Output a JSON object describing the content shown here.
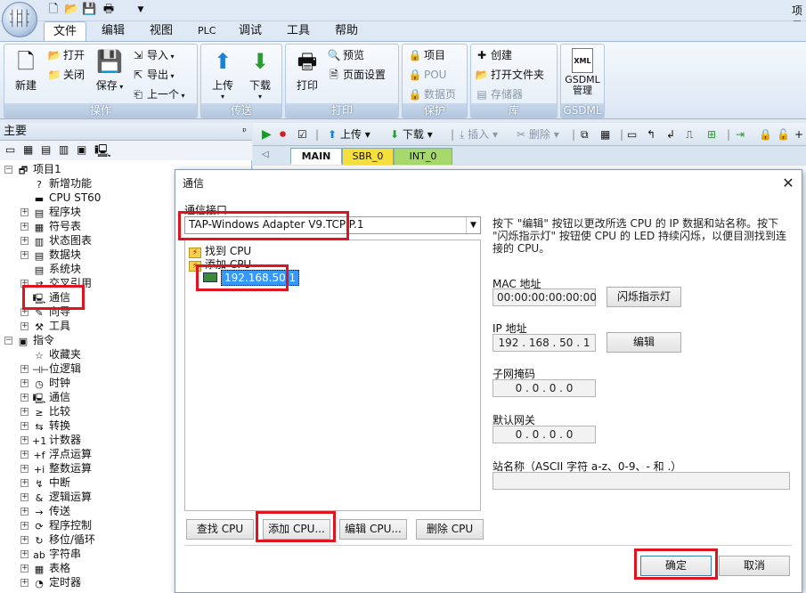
{
  "window": {
    "title_fragment": "项目"
  },
  "qat": {
    "dropdown": "▼"
  },
  "menu": {
    "tabs": [
      "文件",
      "编辑",
      "视图",
      "PLC",
      "调试",
      "工具",
      "帮助"
    ]
  },
  "ribbon": {
    "groups": {
      "operation": {
        "caption": "操作",
        "new_label": "新建",
        "open_label": "打开",
        "close_label": "关闭",
        "save_label": "保存",
        "import_label": "导入",
        "export_label": "导出",
        "previous_label": "上一个"
      },
      "transfer": {
        "caption": "传送",
        "upload_label": "上传",
        "download_label": "下载"
      },
      "print": {
        "caption": "打印",
        "print_label": "打印",
        "preview_label": "预览",
        "page_setup_label": "页面设置"
      },
      "protect": {
        "caption": "保护",
        "project_label": "项目",
        "pou_label": "POU",
        "data_page_label": "数据页"
      },
      "library": {
        "caption": "库",
        "create_label": "创建",
        "open_folder_label": "打开文件夹",
        "memory_label": "存储器"
      },
      "gsdml": {
        "caption": "GSDML",
        "icon_text": "XML",
        "manage_line1": "GSDML",
        "manage_line2": "管理"
      }
    }
  },
  "left_panel": {
    "header": "主要",
    "pin": "ᵖ",
    "tree": [
      {
        "label": "项目1",
        "indent": 0,
        "expander": "−",
        "icon": "project-icon"
      },
      {
        "label": "新增功能",
        "indent": 1,
        "icon": "help-icon"
      },
      {
        "label": "CPU ST60",
        "indent": 1,
        "icon": "cpu-icon"
      },
      {
        "label": "程序块",
        "indent": 1,
        "expander": "+",
        "icon": "folder-icon"
      },
      {
        "label": "符号表",
        "indent": 1,
        "expander": "+",
        "icon": "table-icon"
      },
      {
        "label": "状态图表",
        "indent": 1,
        "expander": "+",
        "icon": "chart-icon"
      },
      {
        "label": "数据块",
        "indent": 1,
        "expander": "+",
        "icon": "data-block-icon"
      },
      {
        "label": "系统块",
        "indent": 1,
        "icon": "system-block-icon"
      },
      {
        "label": "交叉引用",
        "indent": 1,
        "expander": "+",
        "icon": "cross-ref-icon"
      },
      {
        "label": "通信",
        "indent": 1,
        "icon": "communication-icon"
      },
      {
        "label": "向导",
        "indent": 1,
        "expander": "+",
        "icon": "wizard-icon"
      },
      {
        "label": "工具",
        "indent": 1,
        "expander": "+",
        "icon": "tools-icon"
      },
      {
        "label": "指令",
        "indent": 0,
        "expander": "−",
        "icon": "instructions-icon"
      },
      {
        "label": "收藏夹",
        "indent": 1,
        "icon": "favorites-icon"
      },
      {
        "label": "位逻辑",
        "indent": 1,
        "expander": "+",
        "icon": "bit-logic-icon"
      },
      {
        "label": "时钟",
        "indent": 1,
        "expander": "+",
        "icon": "clock-icon"
      },
      {
        "label": "通信",
        "indent": 1,
        "expander": "+",
        "icon": "communication-icon"
      },
      {
        "label": "比较",
        "indent": 1,
        "expander": "+",
        "icon": "compare-icon"
      },
      {
        "label": "转换",
        "indent": 1,
        "expander": "+",
        "icon": "convert-icon"
      },
      {
        "label": "计数器",
        "indent": 1,
        "expander": "+",
        "icon": "counter-icon"
      },
      {
        "label": "浮点运算",
        "indent": 1,
        "expander": "+",
        "icon": "float-math-icon"
      },
      {
        "label": "整数运算",
        "indent": 1,
        "expander": "+",
        "icon": "integer-math-icon"
      },
      {
        "label": "中断",
        "indent": 1,
        "expander": "+",
        "icon": "interrupt-icon"
      },
      {
        "label": "逻辑运算",
        "indent": 1,
        "expander": "+",
        "icon": "logic-ops-icon"
      },
      {
        "label": "传送",
        "indent": 1,
        "expander": "+",
        "icon": "move-icon"
      },
      {
        "label": "程序控制",
        "indent": 1,
        "expander": "+",
        "icon": "program-control-icon"
      },
      {
        "label": "移位/循环",
        "indent": 1,
        "expander": "+",
        "icon": "shift-rotate-icon"
      },
      {
        "label": "字符串",
        "indent": 1,
        "expander": "+",
        "icon": "string-icon"
      },
      {
        "label": "表格",
        "indent": 1,
        "expander": "+",
        "icon": "table-icon"
      },
      {
        "label": "定时器",
        "indent": 1,
        "expander": "+",
        "icon": "timer-icon"
      }
    ]
  },
  "editor_toolbar": {
    "upload_label": "上传",
    "download_label": "下载",
    "insert_label": "插入",
    "delete_label": "删除"
  },
  "editor_tabs": [
    "MAIN",
    "SBR_0",
    "INT_0"
  ],
  "dialog": {
    "title": "通信",
    "close_glyph": "✕",
    "interface_label": "通信接口",
    "interface_value": "TAP-Windows Adapter V9.TCPIP.1",
    "device_tree": {
      "found_cpu": "找到 CPU",
      "added_cpu": "添加 CPU",
      "device_ip": "192.168.50.1"
    },
    "description": "按下 \"编辑\" 按钮以更改所选 CPU 的 IP 数据和站名称。按下 \"闪烁指示灯\" 按钮使 CPU 的 LED 持续闪烁，以便目测找到连接的 CPU。",
    "mac_label": "MAC 地址",
    "mac_value": "00:00:00:00:00:00",
    "flash_button": "闪烁指示灯",
    "ip_label": "IP 地址",
    "ip_value": "192 . 168 . 50 . 1",
    "edit_button": "编辑",
    "subnet_label": "子网掩码",
    "subnet_value": "0 . 0 . 0 . 0",
    "gateway_label": "默认网关",
    "gateway_value": "0 . 0 . 0 . 0",
    "station_label": "站名称（ASCII 字符 a-z、0-9、- 和 .）",
    "station_value": "",
    "find_cpu_button": "查找 CPU",
    "add_cpu_button": "添加 CPU...",
    "edit_cpu_button": "编辑 CPU...",
    "delete_cpu_button": "删除 CPU",
    "ok_button": "确定",
    "cancel_button": "取消"
  },
  "colors": {
    "highlight": "#e0141e",
    "selection": "#3399ff",
    "ribbon_caption": "#b3c7df"
  }
}
